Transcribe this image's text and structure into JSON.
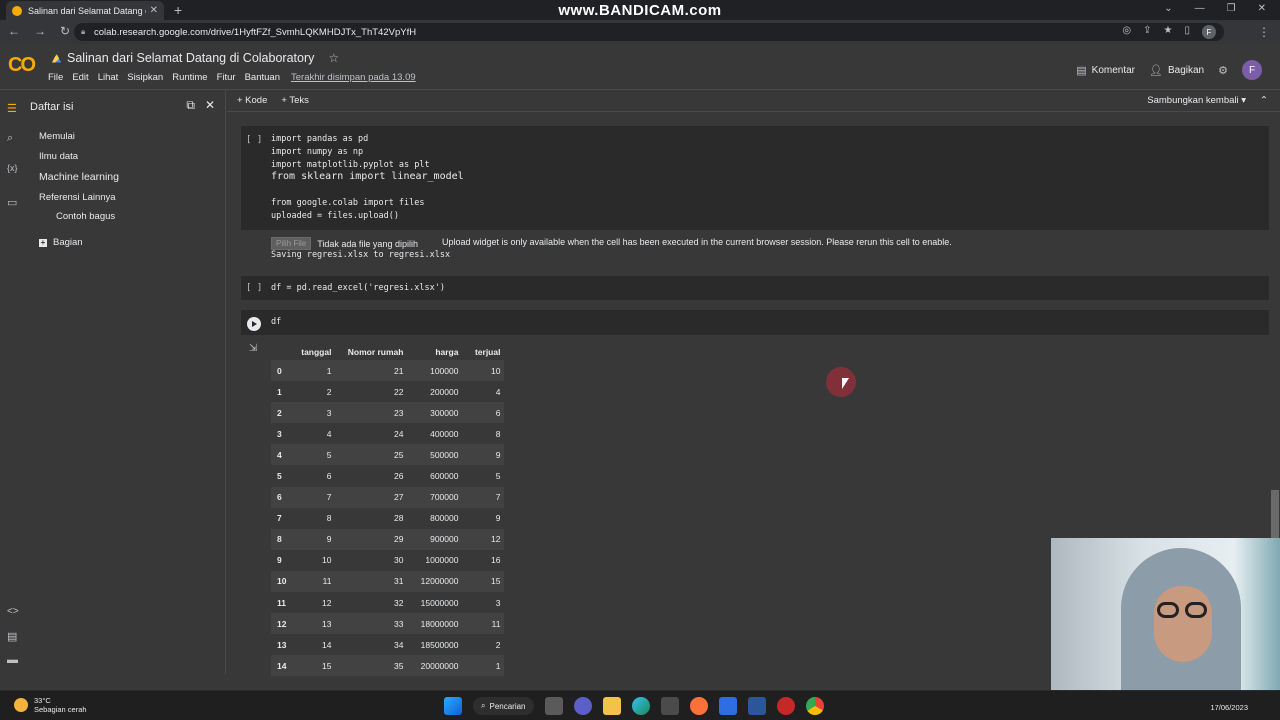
{
  "browser": {
    "tab_title": "Salinan dari Selamat Datang di C",
    "watermark": "www.BANDICAM.com",
    "url": "colab.research.google.com/drive/1HyftFZf_SvmhLQKMHDJTx_ThT42VpYfH",
    "profile_initial": "F"
  },
  "colab": {
    "logo": "CO",
    "notebook_title": "Salinan dari Selamat Datang di Colaboratory",
    "menu": [
      "File",
      "Edit",
      "Lihat",
      "Sisipkan",
      "Runtime",
      "Fitur",
      "Bantuan"
    ],
    "last_saved": "Terakhir disimpan pada 13.09",
    "comment_label": "Komentar",
    "share_label": "Bagikan",
    "avatar_initial": "F"
  },
  "sidebar": {
    "title": "Daftar isi",
    "items": [
      "Memulai",
      "Ilmu data",
      "Machine learning",
      "Referensi Lainnya",
      "Contoh bagus"
    ],
    "add_section": "Bagian"
  },
  "toolbar": {
    "add_code": "+ Kode",
    "add_text": "+ Teks",
    "reconnect": "Sambungkan kembali"
  },
  "cells": {
    "cell1_bracket": "[ ]",
    "cell1_code": [
      "import pandas as pd",
      "import numpy as np",
      "import matplotlib.pyplot as plt",
      "from sklearn import linear_model",
      "",
      "from google.colab import files",
      "uploaded = files.upload()"
    ],
    "upload_button": "Pilih File",
    "no_file": "Tidak ada file yang dipilih",
    "upload_warning": "Upload widget is only available when the cell has been executed in the current browser session. Please rerun this cell to enable.",
    "saving_msg": "Saving regresi.xlsx to regresi.xlsx",
    "cell2_bracket": "[ ]",
    "cell2_code": "df = pd.read_excel('regresi.xlsx')",
    "cell3_code": "df"
  },
  "dataframe": {
    "columns": [
      "",
      "tanggal",
      "Nomor rumah",
      "harga",
      "terjual"
    ],
    "rows": [
      [
        "0",
        "1",
        "21",
        "100000",
        "10"
      ],
      [
        "1",
        "2",
        "22",
        "200000",
        "4"
      ],
      [
        "2",
        "3",
        "23",
        "300000",
        "6"
      ],
      [
        "3",
        "4",
        "24",
        "400000",
        "8"
      ],
      [
        "4",
        "5",
        "25",
        "500000",
        "9"
      ],
      [
        "5",
        "6",
        "26",
        "600000",
        "5"
      ],
      [
        "6",
        "7",
        "27",
        "700000",
        "7"
      ],
      [
        "7",
        "8",
        "28",
        "800000",
        "9"
      ],
      [
        "8",
        "9",
        "29",
        "900000",
        "12"
      ],
      [
        "9",
        "10",
        "30",
        "1000000",
        "16"
      ],
      [
        "10",
        "11",
        "31",
        "12000000",
        "15"
      ],
      [
        "11",
        "12",
        "32",
        "15000000",
        "3"
      ],
      [
        "12",
        "13",
        "33",
        "18000000",
        "11"
      ],
      [
        "13",
        "14",
        "34",
        "18500000",
        "2"
      ],
      [
        "14",
        "15",
        "35",
        "20000000",
        "1"
      ]
    ]
  },
  "taskbar": {
    "temperature": "33°C",
    "weather": "Sebagian cerah",
    "search": "Pencarian",
    "date": "17/06/2023"
  }
}
